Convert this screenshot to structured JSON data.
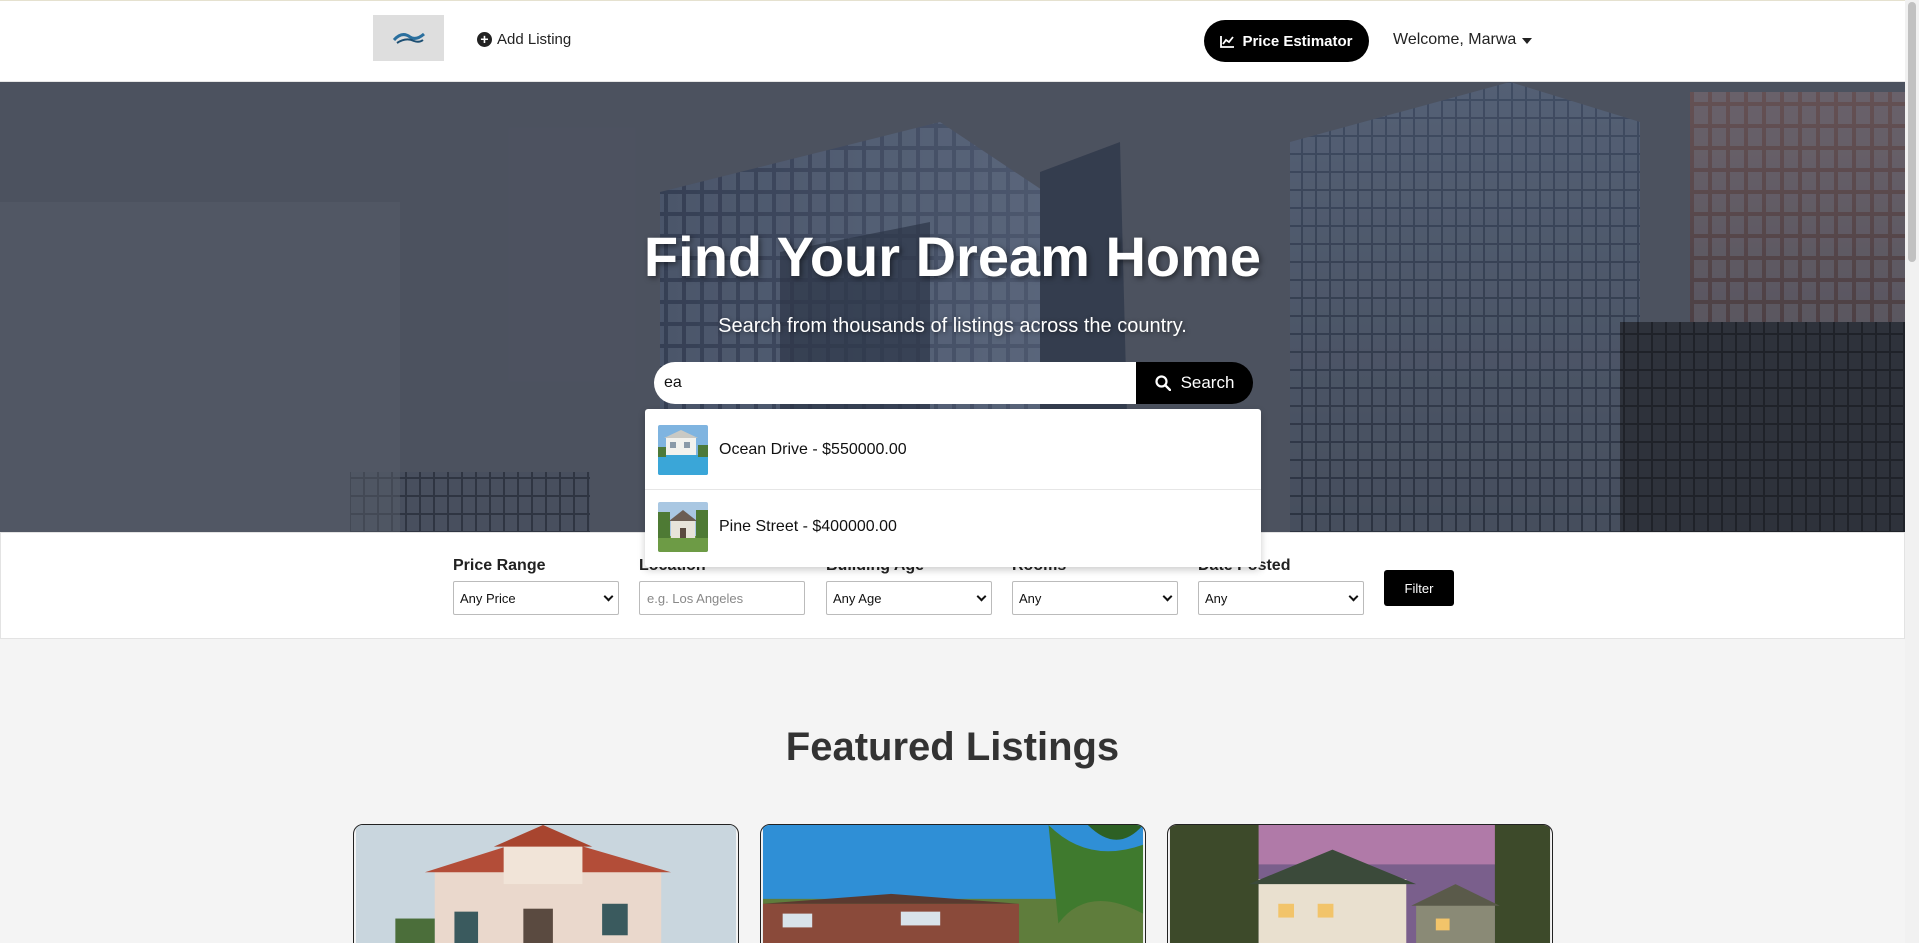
{
  "nav": {
    "add_listing": "Add Listing",
    "price_estimator": "Price Estimator",
    "welcome": "Welcome, Marwa"
  },
  "hero": {
    "title": "Find Your Dream Home",
    "subtitle": "Search from thousands of listings across the country.",
    "search_value": "ea",
    "search_button": "Search"
  },
  "suggestions": [
    {
      "label": "Ocean Drive - $550000.00"
    },
    {
      "label": "Pine Street - $400000.00"
    }
  ],
  "filters": {
    "price": {
      "label": "Price Range",
      "value": "Any Price"
    },
    "location": {
      "label": "Location",
      "placeholder": "e.g. Los Angeles"
    },
    "age": {
      "label": "Building Age",
      "value": "Any Age"
    },
    "rooms": {
      "label": "Rooms",
      "value": "Any"
    },
    "date": {
      "label": "Date Posted",
      "value": "Any"
    },
    "button": "Filter"
  },
  "featured": {
    "title": "Featured Listings"
  },
  "colors": {
    "accent": "#000000",
    "background": "#f4f4f4"
  }
}
